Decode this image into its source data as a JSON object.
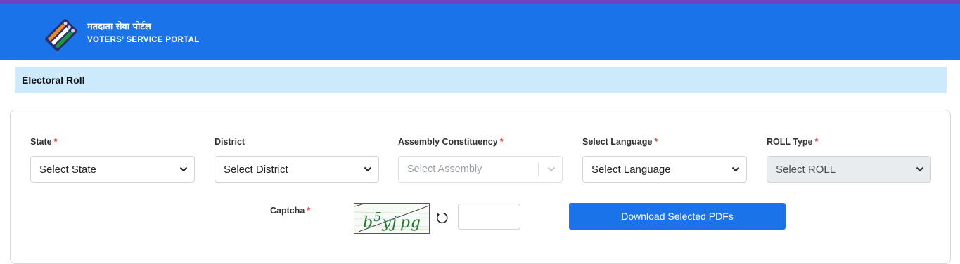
{
  "header": {
    "brand_hindi": "मतदाता सेवा पोर्टल",
    "brand_english": "VOTERS’ SERVICE PORTAL",
    "background": "#1a73e8",
    "top_strip": "#6f42c1"
  },
  "page": {
    "title": "Electoral Roll"
  },
  "form": {
    "state": {
      "label": "State",
      "required": "*",
      "value": "Select State"
    },
    "district": {
      "label": "District",
      "value": "Select District"
    },
    "assembly": {
      "label": "Assembly Constituency",
      "required": "*",
      "placeholder": "Select Assembly"
    },
    "language": {
      "label": "Select Language",
      "required": "*",
      "value": "Select Language"
    },
    "roll_type": {
      "label": "ROLL Type",
      "required": "*",
      "value": "Select ROLL"
    },
    "captcha": {
      "label": "Captcha",
      "required": "*",
      "text": "b5yjpg",
      "input_value": ""
    },
    "download_label": "Download Selected PDFs"
  },
  "icons": {
    "logo": "ballot-logo-icon",
    "chevron": "chevron-down-icon",
    "refresh": "refresh-icon"
  },
  "colors": {
    "accent": "#1a73e8",
    "required": "#e03131",
    "pagebar": "#cdeafc"
  }
}
